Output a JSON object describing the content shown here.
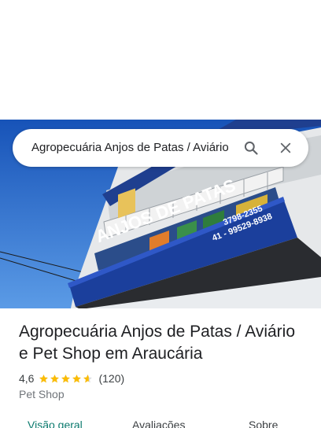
{
  "search": {
    "value": "Agropecuária Anjos de Patas / Aviário e Pet Shop em Araucária",
    "search_icon": "search-icon",
    "close_icon": "close-icon"
  },
  "photo": {
    "sign_main": "ANJOS DE PATAS",
    "phone_1": "3798-2355",
    "phone_2": "41 - 99529-8938"
  },
  "place": {
    "title": "Agropecuária Anjos de Patas / Aviário e Pet Shop em Araucária",
    "rating": "4,6",
    "rating_stars": 4.6,
    "review_count": "(120)",
    "category": "Pet Shop"
  },
  "tabs": [
    {
      "label": "Visão geral",
      "active": true
    },
    {
      "label": "Avaliações",
      "active": false
    },
    {
      "label": "Sobre",
      "active": false
    }
  ],
  "colors": {
    "star": "#fbbc04",
    "active_tab": "#0b7a6e",
    "sign_blue": "#1b3f9c"
  }
}
